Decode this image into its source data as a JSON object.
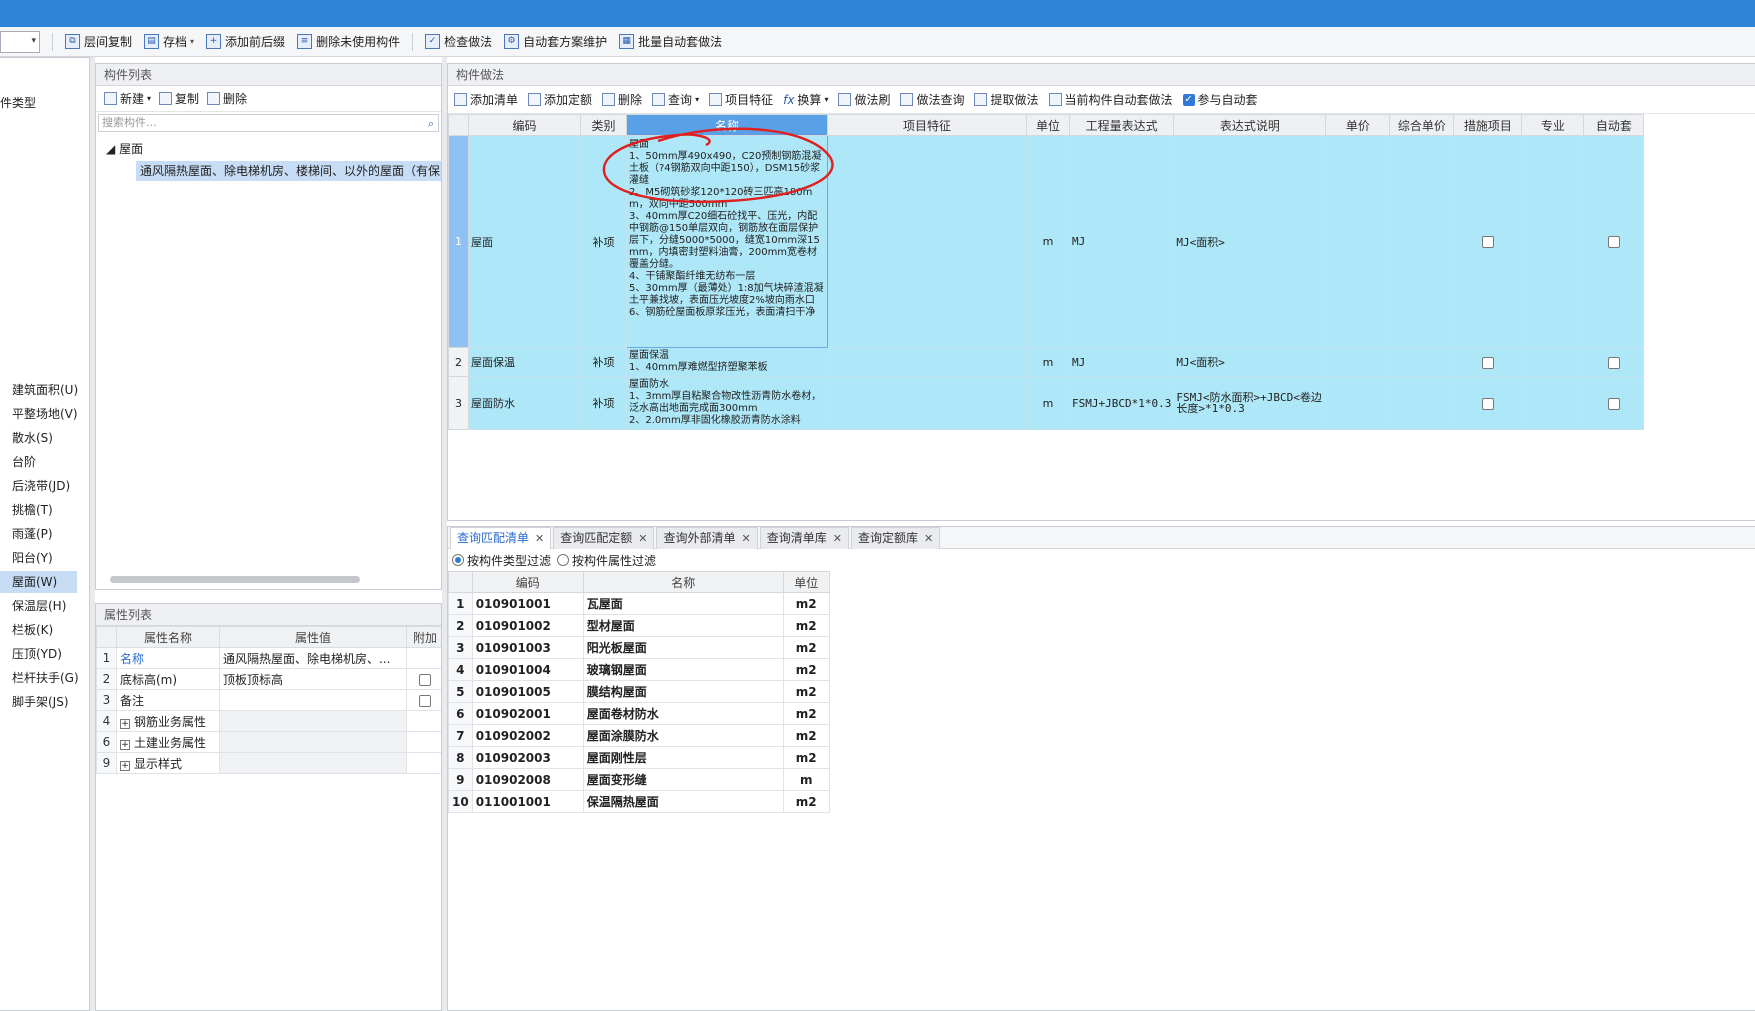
{
  "toolbar": {
    "buttons": [
      "层间复制",
      "存档",
      "添加前后缀",
      "删除未使用构件",
      "检查做法",
      "自动套方案维护",
      "批量自动套做法"
    ]
  },
  "leftnav": {
    "top_label": "件类型",
    "items": [
      "建筑面积(U)",
      "平整场地(V)",
      "散水(S)",
      "台阶",
      "后浇带(JD)",
      "挑檐(T)",
      "雨蓬(P)",
      "阳台(Y)",
      "屋面(W)",
      "保温层(H)",
      "栏板(K)",
      "压顶(YD)",
      "栏杆扶手(G)",
      "脚手架(JS)"
    ]
  },
  "complist": {
    "title": "构件列表",
    "new": "新建",
    "copy": "复制",
    "delete": "删除",
    "search_placeholder": "搜索构件...",
    "tree_root": "屋面",
    "tree_child": "通风隔热屋面、除电梯机房、楼梯间、以外的屋面（有保"
  },
  "proplist": {
    "title": "属性列表",
    "headers": [
      "属性名称",
      "属性值",
      "附加"
    ],
    "rows": [
      {
        "idx": "1",
        "name": "名称",
        "value": "通风隔热屋面、除电梯机房、..."
      },
      {
        "idx": "2",
        "name": "底标高(m)",
        "value": "顶板顶标高"
      },
      {
        "idx": "3",
        "name": "备注",
        "value": ""
      },
      {
        "idx": "4",
        "name": "钢筋业务属性",
        "value": ""
      },
      {
        "idx": "6",
        "name": "土建业务属性",
        "value": ""
      },
      {
        "idx": "9",
        "name": "显示样式",
        "value": ""
      }
    ]
  },
  "method": {
    "title": "构件做法",
    "toolbar": [
      "添加清单",
      "添加定额",
      "删除",
      "查询",
      "项目特征",
      "换算",
      "做法刷",
      "做法查询",
      "提取做法",
      "当前构件自动套做法",
      "参与自动套"
    ],
    "headers": [
      "编码",
      "类别",
      "名称",
      "项目特征",
      "单位",
      "工程量表达式",
      "表达式说明",
      "单价",
      "综合单价",
      "措施项目",
      "专业",
      "自动套"
    ],
    "rows": [
      {
        "idx": "1",
        "code": "屋面",
        "type": "补项",
        "name": "屋面\n1、50mm厚490x490，C20预制钢筋混凝土板（?4钢筋双向中距150），DSM15砂浆灌缝\n2、M5砌筑砂浆120*120砖三匹高180mm，双向中距500mm\n3、40mm厚C20细石砼找平、压光，内配中钢筋@150单层双向，钢筋放在面层保护层下，分缝5000*5000，缝宽10mm深15mm，内填密封塑料油膏，200mm宽卷材覆盖分缝。\n4、干铺聚酯纤维无纺布一层\n5、30mm厚（最薄处）1:8加气块碎渣混凝土平兼找坡，表面压光坡度2%坡向雨水口\n6、钢筋砼屋面板原浆压光，表面清扫干净",
        "unit": "m",
        "expr": "MJ",
        "expr_desc": "MJ<面积>"
      },
      {
        "idx": "2",
        "code": "屋面保温",
        "type": "补项",
        "name": "屋面保温\n1、40mm厚难燃型挤塑聚苯板",
        "unit": "m",
        "expr": "MJ",
        "expr_desc": "MJ<面积>"
      },
      {
        "idx": "3",
        "code": "屋面防水",
        "type": "补项",
        "name": "屋面防水\n1、3mm厚自粘聚合物改性沥青防水卷材，泛水高出地面完成面300mm\n2、2.0mm厚非固化橡胶沥青防水涂料",
        "unit": "m",
        "expr": "FSMJ+JBCD*1*0.3",
        "expr_desc": "FSMJ<防水面积>+JBCD<卷边长度>*1*0.3"
      }
    ]
  },
  "query": {
    "tabs": [
      "查询匹配清单",
      "查询匹配定额",
      "查询外部清单",
      "查询清单库",
      "查询定额库"
    ],
    "filter_type": "按构件类型过滤",
    "filter_attr": "按构件属性过滤",
    "headers": [
      "编码",
      "名称",
      "单位"
    ],
    "rows": [
      {
        "idx": "1",
        "code": "010901001",
        "name": "瓦屋面",
        "unit": "m2"
      },
      {
        "idx": "2",
        "code": "010901002",
        "name": "型材屋面",
        "unit": "m2"
      },
      {
        "idx": "3",
        "code": "010901003",
        "name": "阳光板屋面",
        "unit": "m2"
      },
      {
        "idx": "4",
        "code": "010901004",
        "name": "玻璃钢屋面",
        "unit": "m2"
      },
      {
        "idx": "5",
        "code": "010901005",
        "name": "膜结构屋面",
        "unit": "m2"
      },
      {
        "idx": "6",
        "code": "010902001",
        "name": "屋面卷材防水",
        "unit": "m2"
      },
      {
        "idx": "7",
        "code": "010902002",
        "name": "屋面涂膜防水",
        "unit": "m2"
      },
      {
        "idx": "8",
        "code": "010902003",
        "name": "屋面刚性层",
        "unit": "m2"
      },
      {
        "idx": "9",
        "code": "010902008",
        "name": "屋面变形缝",
        "unit": "m"
      },
      {
        "idx": "10",
        "code": "011001001",
        "name": "保温隔热屋面",
        "unit": "m2"
      }
    ]
  }
}
